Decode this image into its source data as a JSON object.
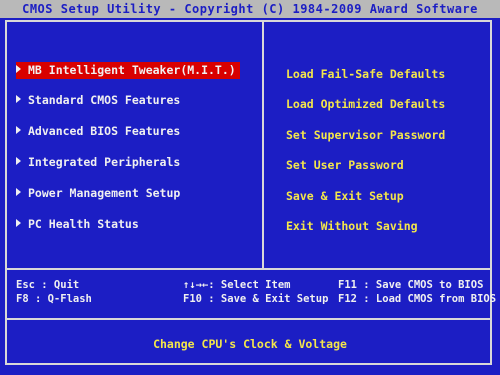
{
  "title": "CMOS Setup Utility - Copyright (C) 1984-2009 Award Software",
  "left_menu": [
    {
      "label": "MB Intelligent Tweaker(M.I.T.)",
      "selected": true
    },
    {
      "label": "Standard CMOS Features"
    },
    {
      "label": "Advanced BIOS Features"
    },
    {
      "label": "Integrated Peripherals"
    },
    {
      "label": "Power Management Setup"
    },
    {
      "label": "PC Health Status"
    }
  ],
  "right_menu": [
    {
      "label": "Load Fail-Safe Defaults"
    },
    {
      "label": "Load Optimized Defaults"
    },
    {
      "label": "Set Supervisor Password"
    },
    {
      "label": "Set User Password"
    },
    {
      "label": "Save & Exit Setup"
    },
    {
      "label": "Exit Without Saving"
    }
  ],
  "legend": {
    "esc": "Esc : Quit",
    "f8": "F8  : Q-Flash",
    "select": "↑↓→←: Select Item",
    "f10": "F10 : Save & Exit Setup",
    "f11": "F11 : Save CMOS to BIOS",
    "f12": "F12 : Load CMOS from BIOS"
  },
  "help_text": "Change CPU's Clock & Voltage",
  "colors": {
    "background": "#1c1ec4",
    "highlight": "#d80000",
    "menu_text": "#f0f0f0",
    "action_text": "#f4e64a"
  }
}
